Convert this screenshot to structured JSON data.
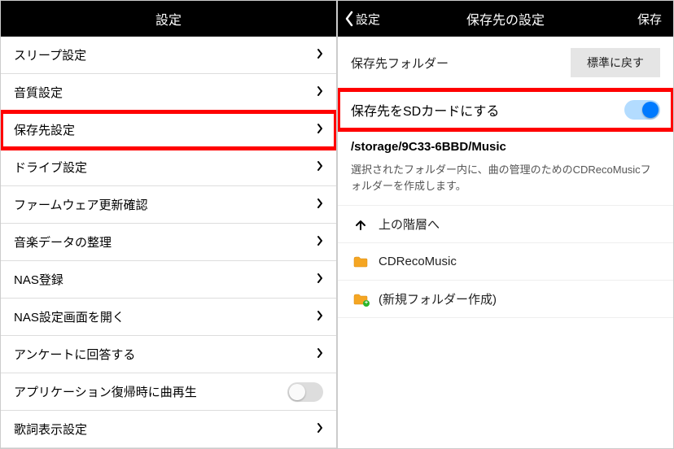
{
  "left": {
    "title": "設定",
    "items": [
      {
        "label": "スリープ設定"
      },
      {
        "label": "音質設定"
      },
      {
        "label": "保存先設定",
        "highlight": true
      },
      {
        "label": "ドライブ設定"
      },
      {
        "label": "ファームウェア更新確認"
      },
      {
        "label": "音楽データの整理"
      },
      {
        "label": "NAS登録"
      },
      {
        "label": "NAS設定画面を開く"
      },
      {
        "label": "アンケートに回答する"
      },
      {
        "label": "アプリケーション復帰時に曲再生",
        "toggle": "off"
      },
      {
        "label": "歌詞表示設定"
      }
    ]
  },
  "right": {
    "back": "設定",
    "title": "保存先の設定",
    "save": "保存",
    "folderLabel": "保存先フォルダー",
    "resetBtn": "標準に戻す",
    "sdLabel": "保存先をSDカードにする",
    "path": "/storage/9C33-6BBD/Music",
    "desc": "選択されたフォルダー内に、曲の管理のためのCDRecoMusicフォルダーを作成します。",
    "upLabel": "上の階層へ",
    "folders": [
      {
        "label": "CDRecoMusic"
      },
      {
        "label": "(新規フォルダー作成)",
        "new": true
      }
    ]
  }
}
